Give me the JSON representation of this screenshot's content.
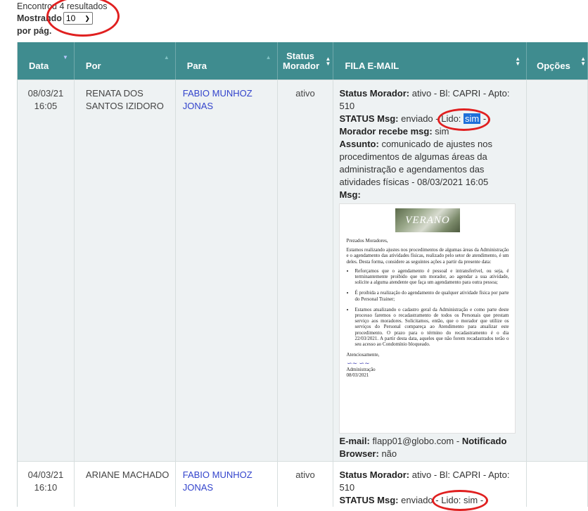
{
  "results": {
    "found_text": "Encontrou 4 resultados",
    "showing_label": "Mostrando",
    "per_page_value": "10",
    "per_page_label": "por pág."
  },
  "table": {
    "headers": {
      "data": "Data",
      "por": "Por",
      "para": "Para",
      "status_morador": "Status Morador",
      "fila_email": "FILA E-MAIL",
      "opcoes": "Opções"
    },
    "rows": [
      {
        "date": "08/03/21",
        "time": "16:05",
        "por": "RENATA DOS SANTOS IZIDORO",
        "para": "FABIO MUNHOZ JONAS",
        "status": "ativo",
        "fila": {
          "status_morador_label": "Status Morador:",
          "status_morador_value": "ativo - Bl: CAPRI - Apto: 510",
          "status_msg_label": "STATUS Msg:",
          "status_msg_value": "enviado -",
          "lido_label": "Lido:",
          "lido_value": "sim",
          "lido_suffix": "-",
          "morador_recebe_label": "Morador recebe msg:",
          "morador_recebe_value": "sim",
          "assunto_label": "Assunto:",
          "assunto_value": "comunicado de ajustes nos procedimentos de algumas áreas da administração e agendamentos das atividades físicas - 08/03/2021 16:05",
          "msg_label": "Msg:",
          "email_label": "E-mail:",
          "email_value": "flapp01@globo.com -",
          "notificado": "Notificado",
          "browser_label": "Browser:",
          "browser_value": "não"
        },
        "letter": {
          "banner": "VERANO",
          "greeting": "Prezados Moradores,",
          "intro": "Estamos realizando ajustes nos procedimentos de algumas áreas da Administração e o agendamento das atividades físicas, realizado pelo setor de atendimento, é um deles. Desta forma, considere as seguintes ações a partir da presente data:",
          "bullets": [
            "Reforçamos que o agendamento é pessoal e intransferível, ou seja, é terminantemente proibido que um morador, ao agendar a sua atividade, solicite a alguma atendente que faça um agendamento para outra pessoa;",
            "É proibida a realização do agendamento de qualquer atividade física por parte do Personal Trainer;",
            "Estamos atualizando o cadastro geral da Administração e como parte deste processo faremos o recadastramento de todos os Personais que prestam serviço aos moradores. Solicitamos, então, que o morador que utilize os serviços do Personal compareça ao Atendimento para atualizar este procedimento. O prazo para o término do recadastramento é o dia 22/03/2021. A partir desta data, aqueles que não forem recadastrados terão o seu acesso ao Condomínio bloqueado."
          ],
          "closing": "Atenciosamente,",
          "sign_name": "Administração",
          "sign_date": "08/03/2021"
        }
      },
      {
        "date": "04/03/21",
        "time": "16:10",
        "por": "ARIANE MACHADO",
        "para": "FABIO MUNHOZ JONAS",
        "status": "ativo",
        "fila": {
          "status_morador_label": "Status Morador:",
          "status_morador_value": "ativo - Bl: CAPRI - Apto: 510",
          "status_msg_label": "STATUS Msg:",
          "status_msg_value": "enviado -",
          "lido_label": "Lido:",
          "lido_value": "sim",
          "lido_suffix": "-"
        }
      }
    ]
  },
  "colors": {
    "header_bg": "#3f8c8f",
    "annotation": "#e02020",
    "link": "#3344cc",
    "highlight": "#1e6fd9"
  }
}
